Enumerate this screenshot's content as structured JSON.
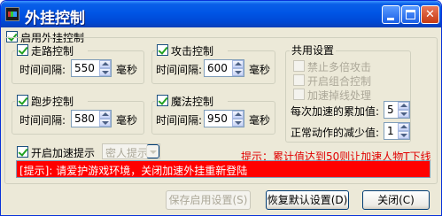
{
  "window": {
    "title": "外挂控制"
  },
  "enable_plugin": {
    "label": "启用外挂控制",
    "checked": true
  },
  "walk": {
    "label": "走路控制",
    "checked": true,
    "interval_label": "时间间隔:",
    "interval_value": "550",
    "unit": "毫秒"
  },
  "attack": {
    "label": "攻击控制",
    "checked": true,
    "interval_label": "时间间隔:",
    "interval_value": "600",
    "unit": "毫秒"
  },
  "run": {
    "label": "跑步控制",
    "checked": true,
    "interval_label": "时间间隔:",
    "interval_value": "580",
    "unit": "毫秒"
  },
  "magic": {
    "label": "魔法控制",
    "checked": true,
    "interval_label": "时间间隔:",
    "interval_value": "950",
    "unit": "毫秒"
  },
  "common": {
    "title": "共用设置",
    "options": [
      {
        "label": "禁止多倍攻击",
        "checked": false,
        "enabled": false
      },
      {
        "label": "开启组合控制",
        "checked": false,
        "enabled": false
      },
      {
        "label": "加速掉线处理",
        "checked": false,
        "enabled": false
      }
    ],
    "accum_label": "每次加速的累加值:",
    "accum_value": "5",
    "decrease_label": "正常动作的减少值:",
    "decrease_value": "1"
  },
  "speed_tip": {
    "label": "开启加速提示",
    "checked": true,
    "combo_value": "密人提示"
  },
  "hint_red": "提示：累计值达到50则让加速人物T下线",
  "status_bar": "[提示]: 请爱护游戏环境，关闭加速外挂重新登陆",
  "buttons": {
    "save": "保存启用设置(S)",
    "restore": "恢复默认设置(D)",
    "close": "关闭(C)"
  },
  "colors": {
    "titlebar": "#0055e5",
    "status_bar_bg": "#ff0000",
    "hint_text": "#e00000"
  }
}
